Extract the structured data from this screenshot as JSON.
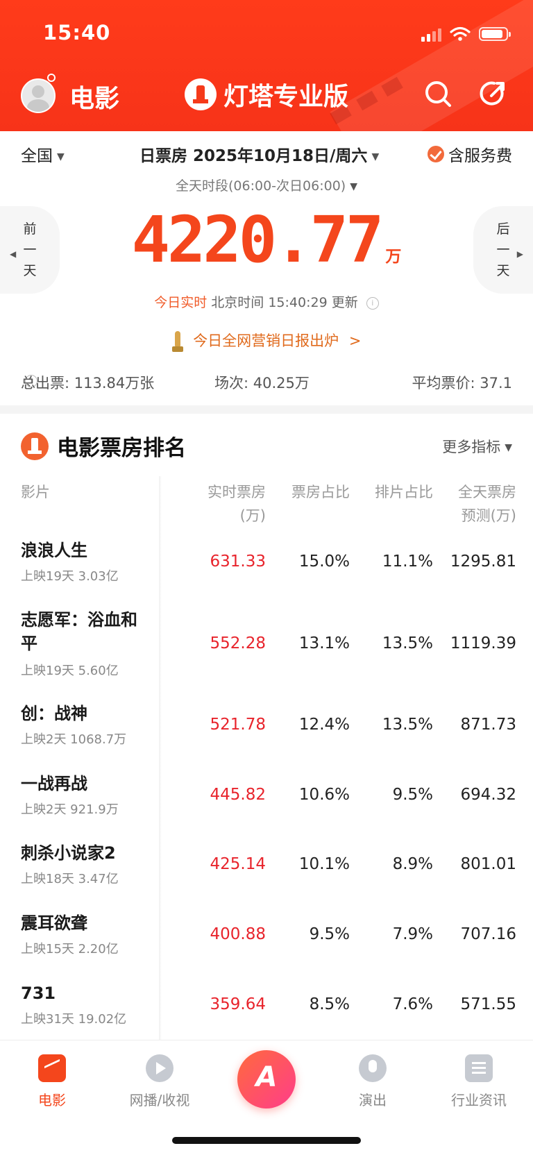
{
  "status_bar": {
    "time": "15:40"
  },
  "header": {
    "title": "电影",
    "brand": "灯塔专业版"
  },
  "filters": {
    "region": "全国",
    "date": "日票房 2025年10月18日/周六",
    "service_fee": "含服务费",
    "period": "全天时段(06:00-次日06:00)"
  },
  "day_nav": {
    "prev": [
      "前",
      "一",
      "天"
    ],
    "next": [
      "后",
      "一",
      "天"
    ]
  },
  "box_office": {
    "value": "4220.77",
    "unit": "万"
  },
  "update": {
    "realtime_label": "今日实时",
    "time_text": "北京时间 15:40:29 更新"
  },
  "report_link": "今日全网营销日报出炉",
  "stats": {
    "tickets": "总出票: 113.84万张",
    "shows": "场次: 40.25万",
    "avg_price": "平均票价: 37.1"
  },
  "ranking": {
    "title": "电影票房排名",
    "more": "更多指标",
    "headers": {
      "film": "影片",
      "realtime": [
        "实时票房",
        "(万)"
      ],
      "bo_share": "票房占比",
      "show_share": "排片占比",
      "forecast": [
        "全天票房",
        "预测(万)"
      ]
    },
    "rows": [
      {
        "name": "浪浪人生",
        "sub": "上映19天 3.03亿",
        "bo": "631.33",
        "bo_share": "15.0%",
        "show_share": "11.1%",
        "forecast": "1295.81"
      },
      {
        "name": "志愿军：浴血和平",
        "sub": "上映19天 5.60亿",
        "bo": "552.28",
        "bo_share": "13.1%",
        "show_share": "13.5%",
        "forecast": "1119.39"
      },
      {
        "name": "创：战神",
        "sub": "上映2天 1068.7万",
        "bo": "521.78",
        "bo_share": "12.4%",
        "show_share": "13.5%",
        "forecast": "871.73"
      },
      {
        "name": "一战再战",
        "sub": "上映2天 921.9万",
        "bo": "445.82",
        "bo_share": "10.6%",
        "show_share": "9.5%",
        "forecast": "694.32"
      },
      {
        "name": "刺杀小说家2",
        "sub": "上映18天 3.47亿",
        "bo": "425.14",
        "bo_share": "10.1%",
        "show_share": "8.9%",
        "forecast": "801.01"
      },
      {
        "name": "震耳欲聋",
        "sub": "上映15天 2.20亿",
        "bo": "400.88",
        "bo_share": "9.5%",
        "show_share": "7.9%",
        "forecast": "707.16"
      },
      {
        "name": "731",
        "sub": "上映31天 19.02亿",
        "bo": "359.64",
        "bo_share": "8.5%",
        "show_share": "7.6%",
        "forecast": "571.55"
      }
    ]
  },
  "tabbar": {
    "movie": "电影",
    "stream": "网播/收视",
    "center": "A",
    "show": "演出",
    "news": "行业资讯"
  },
  "colors": {
    "brand_red": "#f4461c",
    "box_office_red": "#e8232b"
  }
}
